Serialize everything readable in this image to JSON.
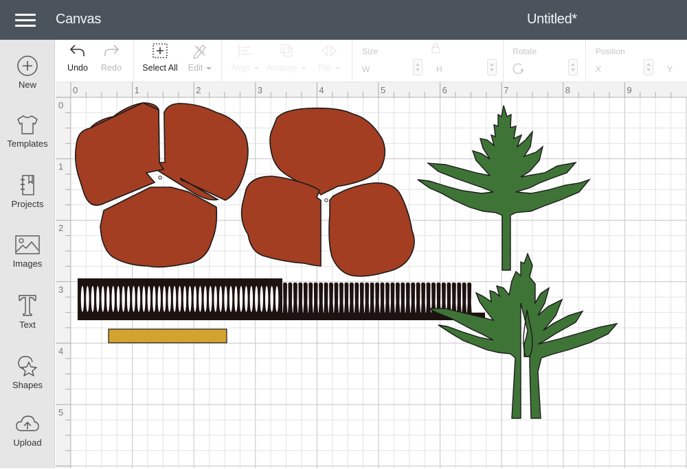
{
  "header": {
    "menu_icon": "hamburger-icon",
    "app_title": "Canvas",
    "document_title": "Untitled*"
  },
  "sidebar": {
    "items": [
      {
        "label": "New",
        "icon": "plus-circle-icon"
      },
      {
        "label": "Templates",
        "icon": "tshirt-icon"
      },
      {
        "label": "Projects",
        "icon": "notebook-icon"
      },
      {
        "label": "Images",
        "icon": "image-icon"
      },
      {
        "label": "Text",
        "icon": "text-t-icon"
      },
      {
        "label": "Shapes",
        "icon": "shapes-icon"
      },
      {
        "label": "Upload",
        "icon": "cloud-upload-icon"
      }
    ]
  },
  "toolbar": {
    "undo": "Undo",
    "redo": "Redo",
    "select_all": "Select All",
    "edit": "Edit",
    "align": "Align",
    "arrange": "Arrange",
    "flip": "Flip",
    "size": {
      "label": "Size",
      "w_label": "W",
      "h_label": "H",
      "w_value": "",
      "h_value": ""
    },
    "rotate": {
      "label": "Rotate",
      "value": ""
    },
    "position": {
      "label": "Position",
      "x_label": "X",
      "y_label": "Y",
      "x_value": "",
      "y_value": ""
    }
  },
  "rulers": {
    "unit": "in",
    "horizontal_labels": [
      "0",
      "1",
      "2",
      "3",
      "4",
      "5",
      "6",
      "7",
      "8",
      "9"
    ],
    "vertical_labels": [
      "0",
      "1",
      "2",
      "3",
      "4",
      "5"
    ]
  },
  "canvas": {
    "grid_subdivisions_per_inch": 4,
    "colors": {
      "petal": "#a33e22",
      "fringe": "#1e1210",
      "stem_strip": "#d4a22e",
      "leaf": "#3f7437",
      "outline": "#1a1a1a",
      "grid_minor": "#e2e2e2",
      "grid_major": "#c4c4c4"
    },
    "objects": [
      {
        "name": "poppy-petal-set-1",
        "type": "three-petal flower"
      },
      {
        "name": "poppy-petal-set-2",
        "type": "three-petal flower"
      },
      {
        "name": "fringe-center-strip",
        "type": "fringe"
      },
      {
        "name": "yellow-strip",
        "type": "rectangle"
      },
      {
        "name": "poppy-leaf-1",
        "type": "leaf"
      },
      {
        "name": "poppy-leaf-2",
        "type": "leaf"
      }
    ]
  }
}
